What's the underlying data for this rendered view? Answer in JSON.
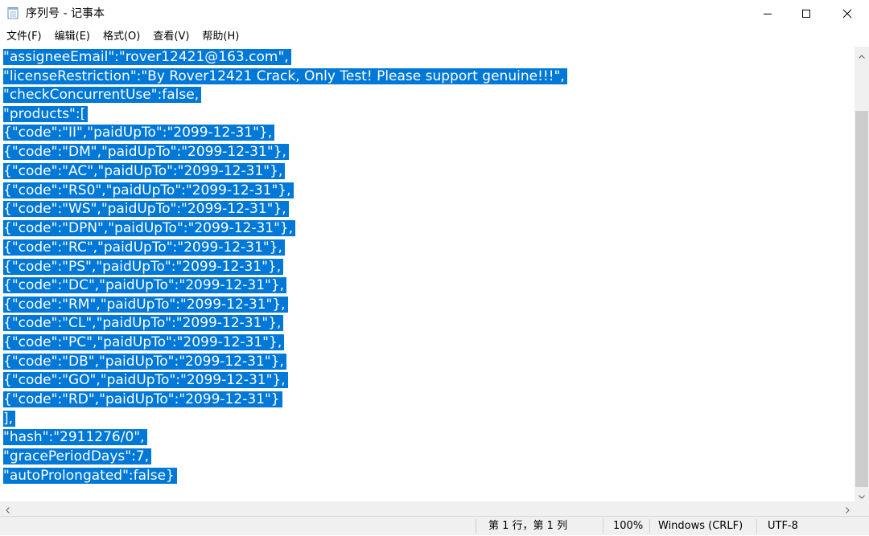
{
  "window": {
    "title": "序列号 - 记事本"
  },
  "menu": {
    "file": "文件(F)",
    "edit": "编辑(E)",
    "format": "格式(O)",
    "view": "查看(V)",
    "help": "帮助(H)"
  },
  "editor": {
    "lines": [
      "\"assigneeEmail\":\"rover12421@163.com\",",
      "\"licenseRestriction\":\"By Rover12421 Crack, Only Test! Please support genuine!!!\",",
      "\"checkConcurrentUse\":false,",
      "\"products\":[",
      "{\"code\":\"II\",\"paidUpTo\":\"2099-12-31\"},",
      "{\"code\":\"DM\",\"paidUpTo\":\"2099-12-31\"},",
      "{\"code\":\"AC\",\"paidUpTo\":\"2099-12-31\"},",
      "{\"code\":\"RS0\",\"paidUpTo\":\"2099-12-31\"},",
      "{\"code\":\"WS\",\"paidUpTo\":\"2099-12-31\"},",
      "{\"code\":\"DPN\",\"paidUpTo\":\"2099-12-31\"},",
      "{\"code\":\"RC\",\"paidUpTo\":\"2099-12-31\"},",
      "{\"code\":\"PS\",\"paidUpTo\":\"2099-12-31\"},",
      "{\"code\":\"DC\",\"paidUpTo\":\"2099-12-31\"},",
      "{\"code\":\"RM\",\"paidUpTo\":\"2099-12-31\"},",
      "{\"code\":\"CL\",\"paidUpTo\":\"2099-12-31\"},",
      "{\"code\":\"PC\",\"paidUpTo\":\"2099-12-31\"},",
      "{\"code\":\"DB\",\"paidUpTo\":\"2099-12-31\"},",
      "{\"code\":\"GO\",\"paidUpTo\":\"2099-12-31\"},",
      "{\"code\":\"RD\",\"paidUpTo\":\"2099-12-31\"}",
      "],",
      "\"hash\":\"2911276/0\",",
      "\"gracePeriodDays\":7,",
      "\"autoProlongated\":false}"
    ],
    "selection_color": "#0078d7"
  },
  "status": {
    "position": "第 1 行，第 1 列",
    "zoom": "100%",
    "line_ending": "Windows (CRLF)",
    "encoding": "UTF-8"
  },
  "icons": {
    "app": "notepad-icon",
    "minimize": "minimize-icon",
    "maximize": "maximize-icon",
    "close": "close-icon"
  }
}
